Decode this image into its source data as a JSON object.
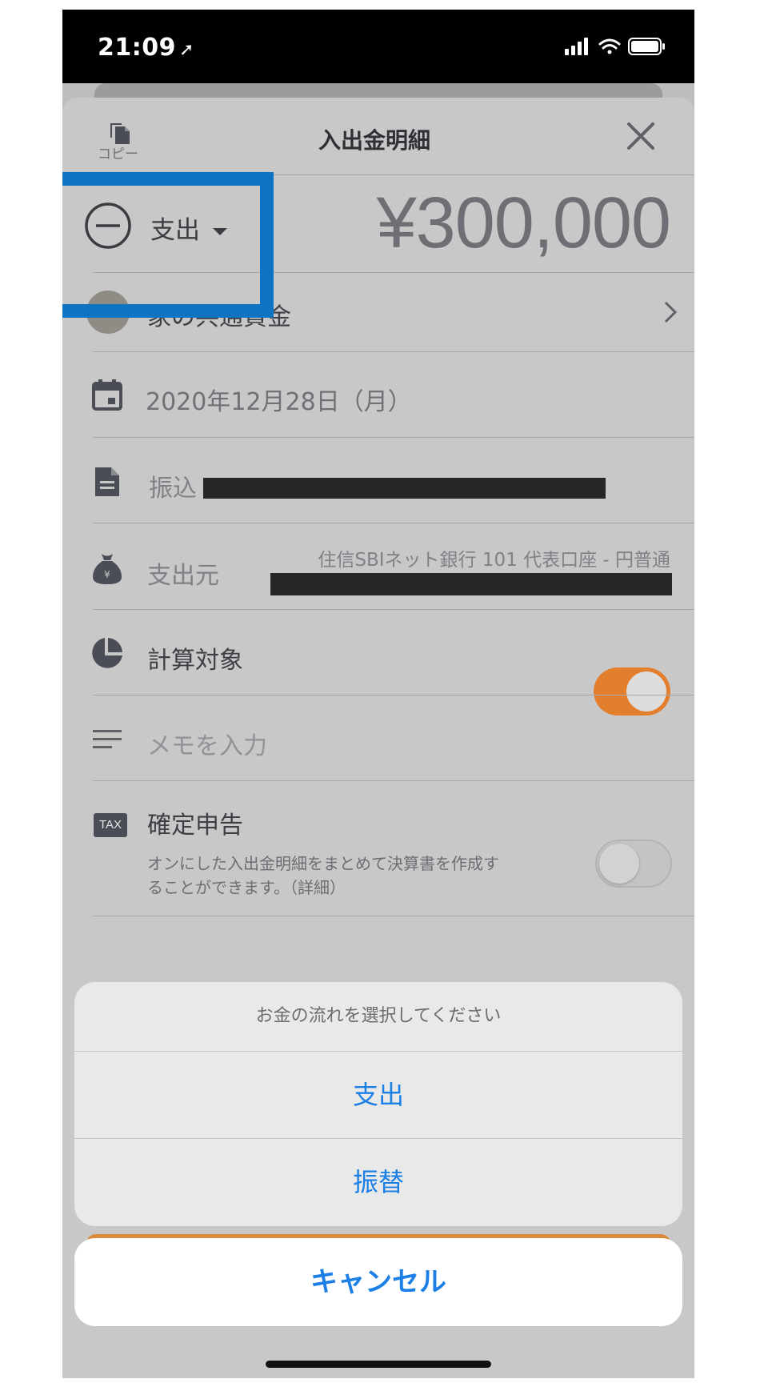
{
  "status_bar": {
    "time": "21:09",
    "location_arrow": "➚"
  },
  "header": {
    "copy_label": "コピー",
    "title": "入出金明細",
    "copy_icon": "copy-icon",
    "close_icon": "close-icon"
  },
  "transaction": {
    "flow_type": "支出",
    "amount": "¥300,000"
  },
  "rows": {
    "category": "家の共通資金",
    "date": "2020年12月28日（月）",
    "description_prefix": "振込",
    "source_label": "支出元",
    "source_account": "住信SBIネット銀行 101 代表口座 - 円普通",
    "calc_target_label": "計算対象",
    "calc_target_on": true,
    "memo_placeholder": "メモを入力",
    "tax_badge": "TAX",
    "tax_label": "確定申告",
    "tax_desc_line1": "オンにした入出金明細をまとめて決算書を作成す",
    "tax_desc_line2": "ることができます。（詳細）",
    "tax_on": false
  },
  "action_sheet": {
    "title": "お金の流れを選択してください",
    "options": [
      "支出",
      "振替"
    ],
    "cancel": "キャンセル"
  },
  "colors": {
    "highlight_box": "#0f73c4",
    "accent_orange": "#e37e2d",
    "action_blue": "#1b7fe6"
  }
}
